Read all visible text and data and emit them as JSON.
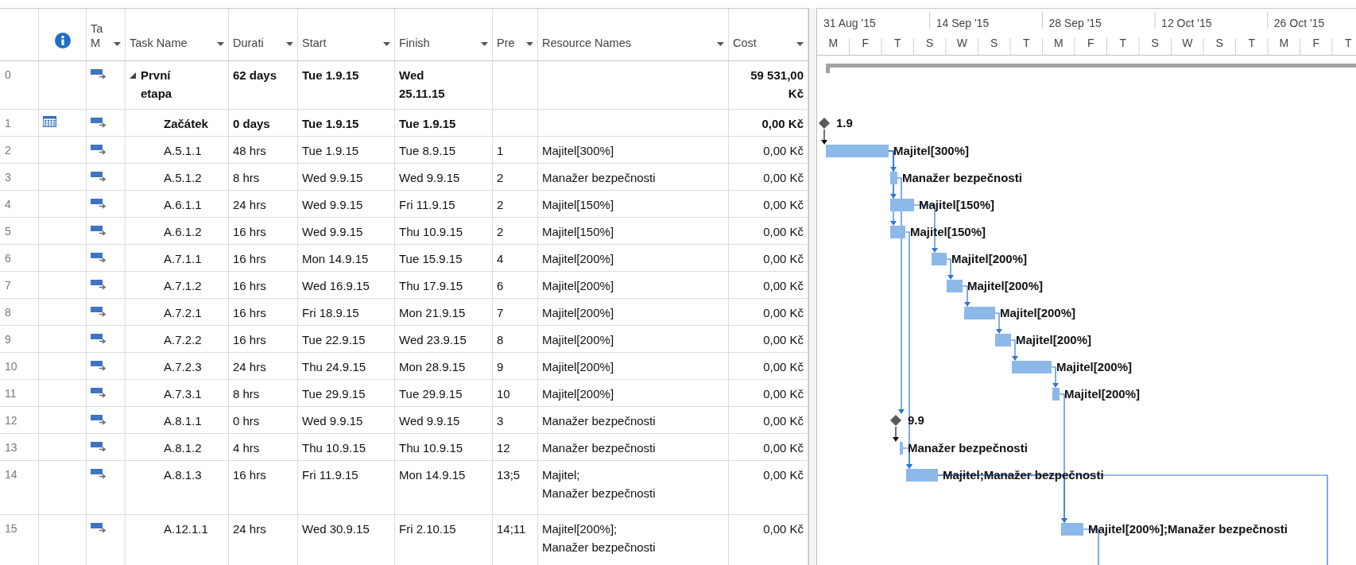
{
  "columns": [
    {
      "kind": "row_number"
    },
    {
      "kind": "indicators"
    },
    {
      "kind": "field",
      "label": "Ta M"
    },
    {
      "kind": "field",
      "label": "Task Name"
    },
    {
      "kind": "field",
      "label": "Durati"
    },
    {
      "kind": "field",
      "label": "Start"
    },
    {
      "kind": "field",
      "label": "Finish"
    },
    {
      "kind": "field",
      "label": "Pre"
    },
    {
      "kind": "field",
      "label": "Resource Names"
    },
    {
      "kind": "field",
      "label": "Cost"
    }
  ],
  "timescale": {
    "major": [
      "31 Aug '15",
      "14 Sep '15",
      "28 Sep '15",
      "12 Oct '15",
      "26 Oct '15"
    ],
    "minor": [
      "M",
      "F",
      "T",
      "S",
      "W",
      "S",
      "T",
      "M",
      "F",
      "T",
      "S",
      "W",
      "S",
      "T",
      "M",
      "F",
      "T"
    ]
  },
  "tasks": [
    {
      "id": "0",
      "kind": "summary",
      "bold": true,
      "expanded": true,
      "name": "První etapa",
      "duration": "62 days",
      "start": "Tue 1.9.15",
      "finish": "Wed 25.11.15",
      "cost": "59 531,00 Kč",
      "children": [
        {
          "id": "1",
          "kind": "milestone",
          "bold": true,
          "calendar_indicator": true,
          "name": "Začátek",
          "duration": "0 days",
          "start": "Tue 1.9.15",
          "finish": "Tue 1.9.15",
          "cost": "0,00 Kč",
          "bar_label": "1.9"
        },
        {
          "id": "2",
          "kind": "task",
          "bold": false,
          "name": "A.5.1.1",
          "duration": "48 hrs",
          "start": "Tue 1.9.15",
          "finish": "Tue 8.9.15",
          "predecessors": "1",
          "resources": "Majitel[300%]",
          "cost": "0,00 Kč",
          "bar_label": "Majitel[300%]"
        },
        {
          "id": "3",
          "kind": "task",
          "bold": false,
          "name": "A.5.1.2",
          "duration": "8 hrs",
          "start": "Wed 9.9.15",
          "finish": "Wed 9.9.15",
          "predecessors": "2",
          "resources": "Manažer bezpečnosti",
          "cost": "0,00 Kč",
          "bar_label": "Manažer bezpečnosti"
        },
        {
          "id": "4",
          "kind": "task",
          "bold": false,
          "name": "A.6.1.1",
          "duration": "24 hrs",
          "start": "Wed 9.9.15",
          "finish": "Fri 11.9.15",
          "predecessors": "2",
          "resources": "Majitel[150%]",
          "cost": "0,00 Kč",
          "bar_label": "Majitel[150%]"
        },
        {
          "id": "5",
          "kind": "task",
          "bold": false,
          "name": "A.6.1.2",
          "duration": "16 hrs",
          "start": "Wed 9.9.15",
          "finish": "Thu 10.9.15",
          "predecessors": "2",
          "resources": "Majitel[150%]",
          "cost": "0,00 Kč",
          "bar_label": "Majitel[150%]"
        },
        {
          "id": "6",
          "kind": "task",
          "bold": false,
          "name": "A.7.1.1",
          "duration": "16 hrs",
          "start": "Mon 14.9.15",
          "finish": "Tue 15.9.15",
          "predecessors": "4",
          "resources": "Majitel[200%]",
          "cost": "0,00 Kč",
          "bar_label": "Majitel[200%]"
        },
        {
          "id": "7",
          "kind": "task",
          "bold": false,
          "name": "A.7.1.2",
          "duration": "16 hrs",
          "start": "Wed 16.9.15",
          "finish": "Thu 17.9.15",
          "predecessors": "6",
          "resources": "Majitel[200%]",
          "cost": "0,00 Kč",
          "bar_label": "Majitel[200%]"
        },
        {
          "id": "8",
          "kind": "task",
          "bold": false,
          "name": "A.7.2.1",
          "duration": "16 hrs",
          "start": "Fri 18.9.15",
          "finish": "Mon 21.9.15",
          "predecessors": "7",
          "resources": "Majitel[200%]",
          "cost": "0,00 Kč",
          "bar_label": "Majitel[200%]"
        },
        {
          "id": "9",
          "kind": "task",
          "bold": false,
          "name": "A.7.2.2",
          "duration": "16 hrs",
          "start": "Tue 22.9.15",
          "finish": "Wed 23.9.15",
          "predecessors": "8",
          "resources": "Majitel[200%]",
          "cost": "0,00 Kč",
          "bar_label": "Majitel[200%]"
        },
        {
          "id": "10",
          "kind": "task",
          "bold": false,
          "name": "A.7.2.3",
          "duration": "24 hrs",
          "start": "Thu 24.9.15",
          "finish": "Mon 28.9.15",
          "predecessors": "9",
          "resources": "Majitel[200%]",
          "cost": "0,00 Kč",
          "bar_label": "Majitel[200%]"
        },
        {
          "id": "11",
          "kind": "task",
          "bold": false,
          "name": "A.7.3.1",
          "duration": "8 hrs",
          "start": "Tue 29.9.15",
          "finish": "Tue 29.9.15",
          "predecessors": "10",
          "resources": "Majitel[200%]",
          "cost": "0,00 Kč",
          "bar_label": "Majitel[200%]"
        },
        {
          "id": "12",
          "kind": "milestone",
          "bold": false,
          "name": "A.8.1.1",
          "duration": "0 hrs",
          "start": "Wed 9.9.15",
          "finish": "Wed 9.9.15",
          "predecessors": "3",
          "resources": "Manažer bezpečnosti",
          "cost": "0,00 Kč",
          "bar_label": "9.9"
        },
        {
          "id": "13",
          "kind": "task",
          "bold": false,
          "name": "A.8.1.2",
          "duration": "4 hrs",
          "start": "Thu 10.9.15",
          "finish": "Thu 10.9.15",
          "predecessors": "12",
          "resources": "Manažer bezpečnosti",
          "cost": "0,00 Kč",
          "bar_label": "Manažer bezpečnosti"
        },
        {
          "id": "14",
          "kind": "task",
          "bold": false,
          "name": "A.8.1.3",
          "duration": "16 hrs",
          "start": "Fri 11.9.15",
          "finish": "Mon 14.9.15",
          "predecessors": "13;5",
          "resources": "Majitel; Manažer bezpečnosti",
          "cost": "0,00 Kč",
          "bar_label": "Majitel;Manažer bezpečnosti"
        },
        {
          "id": "15",
          "kind": "task",
          "bold": false,
          "name": "A.12.1.1",
          "duration": "24 hrs",
          "start": "Wed 30.9.15",
          "finish": "Fri 2.10.15",
          "predecessors": "14;11",
          "resources": "Majitel[200%]; Manažer bezpečnosti",
          "cost": "0,00 Kč",
          "bar_label": "Majitel[200%];Manažer bezpečnosti"
        }
      ]
    }
  ]
}
